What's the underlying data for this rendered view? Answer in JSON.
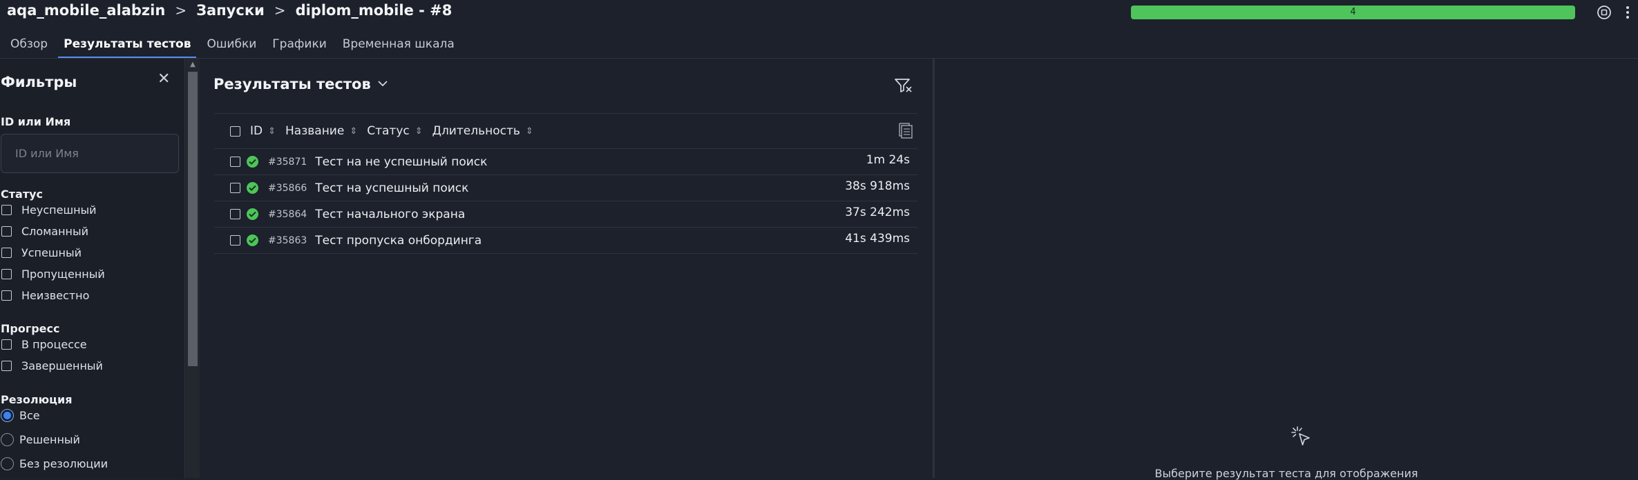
{
  "breadcrumb": {
    "project": "aqa_mobile_alabzin",
    "separator1": ">",
    "launches": "Запуски",
    "separator2": ">",
    "launch": "diplom_mobile - #8"
  },
  "progress": {
    "label": "4",
    "fraction": 1.0,
    "color": "#4ec45a"
  },
  "header_icons": [
    "stop-circle-icon",
    "more-vertical-icon"
  ],
  "tabs": [
    {
      "label": "Обзор",
      "active": false
    },
    {
      "label": "Результаты тестов",
      "active": true
    },
    {
      "label": "Ошибки",
      "active": false
    },
    {
      "label": "Графики",
      "active": false
    },
    {
      "label": "Временная шкала",
      "active": false
    }
  ],
  "filters": {
    "title": "Фильтры",
    "id_name": {
      "label": "ID или Имя",
      "placeholder": "ID или Имя",
      "value": ""
    },
    "status": {
      "label": "Статус",
      "options": [
        "Неуспешный",
        "Сломанный",
        "Успешный",
        "Пропущенный",
        "Неизвестно"
      ]
    },
    "progress": {
      "label": "Прогресс",
      "options": [
        "В процессе",
        "Завершенный"
      ]
    },
    "resolution": {
      "label": "Резолюция",
      "options": [
        "Все",
        "Решенный",
        "Без резолюции"
      ],
      "selected": "Все"
    }
  },
  "results": {
    "title": "Результаты тестов",
    "columns": {
      "id": "ID",
      "name": "Название",
      "status": "Статус",
      "duration": "Длительность"
    },
    "rows": [
      {
        "id": "#35871",
        "name": "Тест на не успешный поиск",
        "duration": "1m 24s",
        "status": "passed"
      },
      {
        "id": "#35866",
        "name": "Тест на успешный поиск",
        "duration": "38s 918ms",
        "status": "passed"
      },
      {
        "id": "#35864",
        "name": "Тест начального экрана",
        "duration": "37s 242ms",
        "status": "passed"
      },
      {
        "id": "#35863",
        "name": "Тест пропуска онбординга",
        "duration": "41s 439ms",
        "status": "passed"
      }
    ]
  },
  "detail": {
    "hint": "Выберите результат теста для отображения"
  },
  "colors": {
    "background": "#1c212b",
    "accent": "#5a8dee",
    "success": "#4ec45a"
  }
}
